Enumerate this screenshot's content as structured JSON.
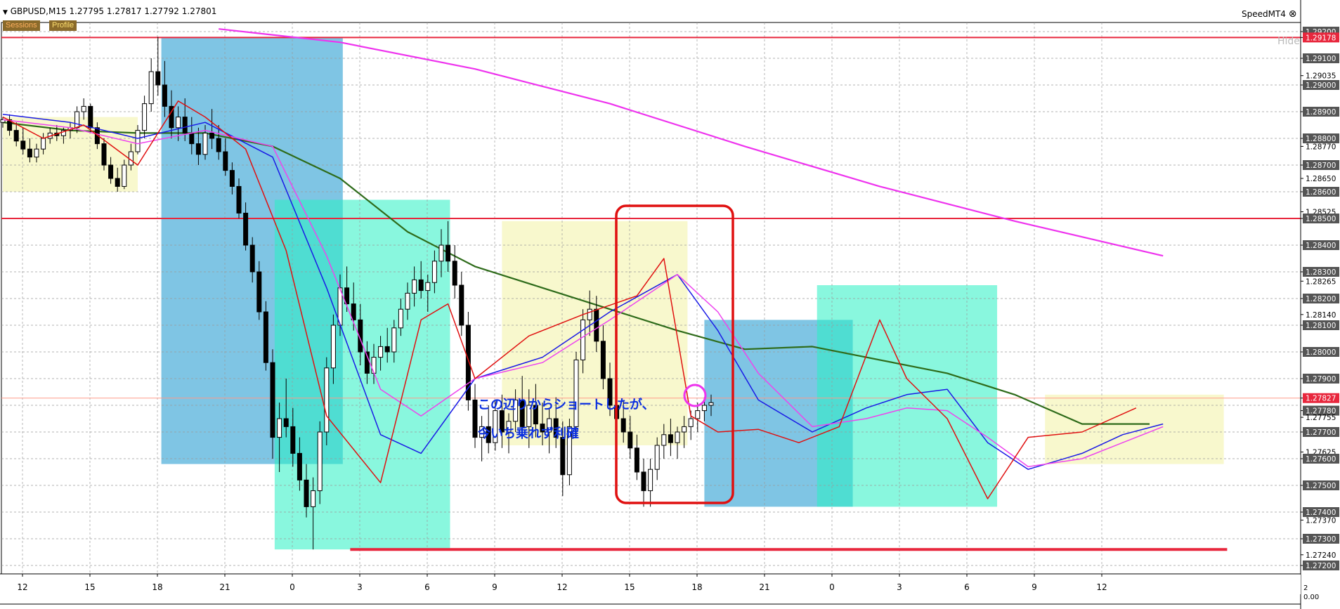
{
  "header": {
    "symbol_info": "GBPUSD,M15",
    "ohlc": "1.27795 1.27817 1.27792 1.27801",
    "indicator_name": "SpeedMT4"
  },
  "buttons": {
    "sessions": "Sessions",
    "profile": "Profile"
  },
  "price_axis_labels": [
    {
      "price": 1.292,
      "text": "1.29200",
      "boxed": true
    },
    {
      "price": 1.29178,
      "text": "1.29178",
      "boxed": true,
      "color": "#e8273d"
    },
    {
      "price": 1.291,
      "text": "1.29100",
      "boxed": true
    },
    {
      "price": 1.29035,
      "text": "1.29035",
      "boxed": false
    },
    {
      "price": 1.29,
      "text": "1.29000",
      "boxed": true
    },
    {
      "price": 1.289,
      "text": "1.28900",
      "boxed": true
    },
    {
      "price": 1.288,
      "text": "1.28800",
      "boxed": true
    },
    {
      "price": 1.2877,
      "text": "1.28770",
      "boxed": false
    },
    {
      "price": 1.287,
      "text": "1.28700",
      "boxed": true
    },
    {
      "price": 1.2865,
      "text": "1.28650",
      "boxed": false
    },
    {
      "price": 1.286,
      "text": "1.28600",
      "boxed": true
    },
    {
      "price": 1.28525,
      "text": "1.28525",
      "boxed": false
    },
    {
      "price": 1.285,
      "text": "1.28500",
      "boxed": true
    },
    {
      "price": 1.284,
      "text": "1.28400",
      "boxed": true
    },
    {
      "price": 1.283,
      "text": "1.28300",
      "boxed": true
    },
    {
      "price": 1.28265,
      "text": "1.28265",
      "boxed": false
    },
    {
      "price": 1.282,
      "text": "1.28200",
      "boxed": true
    },
    {
      "price": 1.2814,
      "text": "1.28140",
      "boxed": false
    },
    {
      "price": 1.281,
      "text": "1.28100",
      "boxed": true
    },
    {
      "price": 1.28,
      "text": "1.28000",
      "boxed": true
    },
    {
      "price": 1.279,
      "text": "1.27900",
      "boxed": true
    },
    {
      "price": 1.27827,
      "text": "1.27827",
      "boxed": true,
      "color": "#e8273d"
    },
    {
      "price": 1.2778,
      "text": "1.27780",
      "boxed": true
    },
    {
      "price": 1.27755,
      "text": "1.27755",
      "boxed": false
    },
    {
      "price": 1.277,
      "text": "1.27700",
      "boxed": true
    },
    {
      "price": 1.27625,
      "text": "1.27625",
      "boxed": false
    },
    {
      "price": 1.276,
      "text": "1.27600",
      "boxed": true
    },
    {
      "price": 1.275,
      "text": "1.27500",
      "boxed": true
    },
    {
      "price": 1.274,
      "text": "1.27400",
      "boxed": true
    },
    {
      "price": 1.2737,
      "text": "1.27370",
      "boxed": false
    },
    {
      "price": 1.273,
      "text": "1.27300",
      "boxed": true
    },
    {
      "price": 1.2724,
      "text": "1.27240",
      "boxed": false
    },
    {
      "price": 1.272,
      "text": "1.27200",
      "boxed": true
    }
  ],
  "time_axis_labels": [
    "12",
    "15",
    "18",
    "21",
    "0",
    "3",
    "6",
    "9",
    "12",
    "15",
    "18",
    "21",
    "0",
    "3",
    "6",
    "9",
    "12"
  ],
  "subpanel_labels": [
    "2",
    "0.00"
  ],
  "hide_label": "Hide",
  "annotations": {
    "line1": "この辺りからショートしたが、",
    "line2": "今いち乗れず利確"
  },
  "colors": {
    "ma_green": "#2e6b1a",
    "ma_magenta_long": "#ee33ee",
    "ma_blue": "#1a1ae6",
    "ma_red": "#e01010",
    "ma_pink": "#ee44ee",
    "hline_red": "#e8273d",
    "annotation_blue": "#0b2fe0"
  },
  "chart_data": {
    "type": "candlestick",
    "symbol": "GBPUSD",
    "timeframe": "M15",
    "ylim": [
      1.2718,
      1.2922
    ],
    "horizontal_lines": [
      1.29178,
      1.285,
      1.27827,
      1.2726
    ],
    "session_boxes": [
      {
        "session": "asia",
        "x": [
          0,
          20
        ],
        "y": [
          1.286,
          1.2888
        ]
      },
      {
        "session": "london",
        "x": [
          23.5,
          50.4
        ],
        "y": [
          1.2758,
          1.29178
        ]
      },
      {
        "session": "newyork",
        "x": [
          40.3,
          66.3
        ],
        "y": [
          1.2726,
          1.2857
        ]
      },
      {
        "session": "asia",
        "x": [
          74,
          101.5
        ],
        "y": [
          1.2765,
          1.2849
        ]
      },
      {
        "session": "london",
        "x": [
          104,
          126
        ],
        "y": [
          1.2742,
          1.2812
        ]
      },
      {
        "session": "newyork",
        "x": [
          120.7,
          147.4
        ],
        "y": [
          1.2742,
          1.2825
        ]
      },
      {
        "session": "asia",
        "x": [
          154.5,
          181
        ],
        "y": [
          1.2758,
          1.2784
        ]
      }
    ],
    "ma_green": [
      [
        0,
        1.2886
      ],
      [
        10,
        1.2883
      ],
      [
        20,
        1.2882
      ],
      [
        30,
        1.2882
      ],
      [
        40,
        1.2877
      ],
      [
        50,
        1.2865
      ],
      [
        60,
        1.2845
      ],
      [
        70,
        1.2832
      ],
      [
        80,
        1.2824
      ],
      [
        90,
        1.2816
      ],
      [
        100,
        1.2808
      ],
      [
        110,
        1.2801
      ],
      [
        120,
        1.2802
      ],
      [
        130,
        1.2797
      ],
      [
        140,
        1.2792
      ],
      [
        150,
        1.2784
      ],
      [
        160,
        1.2773
      ],
      [
        170,
        1.2773
      ]
    ],
    "ma_magenta_long": [
      [
        32,
        1.2921
      ],
      [
        50,
        1.2916
      ],
      [
        70,
        1.2906
      ],
      [
        90,
        1.2893
      ],
      [
        110,
        1.2877
      ],
      [
        130,
        1.2862
      ],
      [
        150,
        1.2849
      ],
      [
        172,
        1.2836
      ]
    ],
    "ma_blue": [
      [
        0,
        1.2889
      ],
      [
        10,
        1.2886
      ],
      [
        20,
        1.288
      ],
      [
        30,
        1.2886
      ],
      [
        40,
        1.2873
      ],
      [
        48,
        1.2824
      ],
      [
        56,
        1.2769
      ],
      [
        62,
        1.2762
      ],
      [
        70,
        1.279
      ],
      [
        80,
        1.2798
      ],
      [
        90,
        1.2815
      ],
      [
        100,
        1.2829
      ],
      [
        106,
        1.2808
      ],
      [
        112,
        1.2782
      ],
      [
        120,
        1.277
      ],
      [
        128,
        1.2779
      ],
      [
        134,
        1.2784
      ],
      [
        140,
        1.2786
      ],
      [
        146,
        1.2766
      ],
      [
        152,
        1.2756
      ],
      [
        160,
        1.2762
      ],
      [
        166,
        1.2769
      ],
      [
        172,
        1.2773
      ]
    ],
    "ma_pink": [
      [
        0,
        1.2887
      ],
      [
        10,
        1.2884
      ],
      [
        20,
        1.2878
      ],
      [
        30,
        1.2883
      ],
      [
        40,
        1.2877
      ],
      [
        48,
        1.2836
      ],
      [
        56,
        1.2786
      ],
      [
        62,
        1.2776
      ],
      [
        70,
        1.279
      ],
      [
        80,
        1.2796
      ],
      [
        90,
        1.2812
      ],
      [
        100,
        1.2829
      ],
      [
        106,
        1.2815
      ],
      [
        112,
        1.2792
      ],
      [
        120,
        1.2772
      ],
      [
        128,
        1.2775
      ],
      [
        134,
        1.2779
      ],
      [
        140,
        1.2778
      ],
      [
        146,
        1.2768
      ],
      [
        152,
        1.2757
      ],
      [
        160,
        1.276
      ],
      [
        166,
        1.2766
      ],
      [
        172,
        1.2772
      ]
    ],
    "ma_red": [
      [
        0,
        1.2888
      ],
      [
        6,
        1.288
      ],
      [
        12,
        1.2885
      ],
      [
        20,
        1.287
      ],
      [
        26,
        1.2894
      ],
      [
        30,
        1.2888
      ],
      [
        36,
        1.2876
      ],
      [
        42,
        1.2838
      ],
      [
        48,
        1.2776
      ],
      [
        56,
        1.2751
      ],
      [
        62,
        1.2812
      ],
      [
        66,
        1.2818
      ],
      [
        70,
        1.279
      ],
      [
        78,
        1.2806
      ],
      [
        86,
        1.2814
      ],
      [
        94,
        1.2821
      ],
      [
        98,
        1.2835
      ],
      [
        102,
        1.2776
      ],
      [
        106,
        1.277
      ],
      [
        112,
        1.2771
      ],
      [
        118,
        1.2766
      ],
      [
        124,
        1.2772
      ],
      [
        130,
        1.2812
      ],
      [
        134,
        1.279
      ],
      [
        140,
        1.2775
      ],
      [
        146,
        1.2745
      ],
      [
        152,
        1.2768
      ],
      [
        160,
        1.277
      ],
      [
        168,
        1.2779
      ]
    ],
    "candles_ohlc": [
      [
        1.2886,
        1.2888,
        1.2884,
        1.2887
      ],
      [
        1.2887,
        1.2889,
        1.2881,
        1.2883
      ],
      [
        1.2883,
        1.2886,
        1.2877,
        1.2879
      ],
      [
        1.2879,
        1.2884,
        1.2874,
        1.2876
      ],
      [
        1.2876,
        1.288,
        1.2871,
        1.2873
      ],
      [
        1.2873,
        1.2878,
        1.2871,
        1.2876
      ],
      [
        1.2876,
        1.2882,
        1.2874,
        1.288
      ],
      [
        1.288,
        1.2884,
        1.2878,
        1.2882
      ],
      [
        1.2882,
        1.2885,
        1.2879,
        1.2881
      ],
      [
        1.2881,
        1.2884,
        1.2878,
        1.2883
      ],
      [
        1.2883,
        1.2886,
        1.288,
        1.2884
      ],
      [
        1.2884,
        1.2892,
        1.2882,
        1.289
      ],
      [
        1.289,
        1.2895,
        1.2887,
        1.2892
      ],
      [
        1.2892,
        1.2893,
        1.2882,
        1.2884
      ],
      [
        1.2884,
        1.2886,
        1.2876,
        1.2878
      ],
      [
        1.2878,
        1.288,
        1.2868,
        1.287
      ],
      [
        1.287,
        1.2873,
        1.2863,
        1.2865
      ],
      [
        1.2865,
        1.2869,
        1.286,
        1.2862
      ],
      [
        1.2862,
        1.2872,
        1.2861,
        1.287
      ],
      [
        1.287,
        1.2878,
        1.2868,
        1.2875
      ],
      [
        1.2875,
        1.2885,
        1.2874,
        1.2883
      ],
      [
        1.2883,
        1.2896,
        1.288,
        1.2893
      ],
      [
        1.2893,
        1.291,
        1.289,
        1.2905
      ],
      [
        1.2905,
        1.2918,
        1.2896,
        1.29
      ],
      [
        1.29,
        1.2909,
        1.2888,
        1.2892
      ],
      [
        1.2892,
        1.2898,
        1.288,
        1.2884
      ],
      [
        1.2884,
        1.2892,
        1.2879,
        1.2888
      ],
      [
        1.2888,
        1.2895,
        1.2879,
        1.2882
      ],
      [
        1.2882,
        1.2888,
        1.2874,
        1.2878
      ],
      [
        1.2878,
        1.2884,
        1.287,
        1.2874
      ],
      [
        1.2874,
        1.2885,
        1.2872,
        1.2882
      ],
      [
        1.2882,
        1.2891,
        1.2876,
        1.288
      ],
      [
        1.288,
        1.2885,
        1.2872,
        1.2875
      ],
      [
        1.2875,
        1.288,
        1.2866,
        1.2868
      ],
      [
        1.2868,
        1.2871,
        1.2859,
        1.2862
      ],
      [
        1.2862,
        1.2865,
        1.285,
        1.2852
      ],
      [
        1.2852,
        1.2856,
        1.2838,
        1.284
      ],
      [
        1.284,
        1.2843,
        1.2826,
        1.283
      ],
      [
        1.283,
        1.2834,
        1.2812,
        1.2815
      ],
      [
        1.2815,
        1.2819,
        1.2793,
        1.2796
      ],
      [
        1.2796,
        1.2801,
        1.276,
        1.2768
      ],
      [
        1.2768,
        1.2781,
        1.2755,
        1.2775
      ],
      [
        1.2775,
        1.279,
        1.2768,
        1.2772
      ],
      [
        1.2772,
        1.2779,
        1.2757,
        1.2762
      ],
      [
        1.2762,
        1.2768,
        1.2748,
        1.2752
      ],
      [
        1.2752,
        1.2758,
        1.2738,
        1.2742
      ],
      [
        1.2742,
        1.2753,
        1.2726,
        1.2748
      ],
      [
        1.2748,
        1.2774,
        1.2743,
        1.277
      ],
      [
        1.277,
        1.2798,
        1.2765,
        1.2794
      ],
      [
        1.2794,
        1.2814,
        1.2788,
        1.281
      ],
      [
        1.281,
        1.2829,
        1.2806,
        1.2824
      ],
      [
        1.2824,
        1.2832,
        1.2815,
        1.2818
      ],
      [
        1.2818,
        1.2826,
        1.2808,
        1.2812
      ],
      [
        1.2812,
        1.2818,
        1.2795,
        1.28
      ],
      [
        1.28,
        1.2804,
        1.2788,
        1.2792
      ],
      [
        1.2792,
        1.2803,
        1.2788,
        1.2798
      ],
      [
        1.2798,
        1.2806,
        1.2793,
        1.2802
      ],
      [
        1.2802,
        1.2809,
        1.2796,
        1.28
      ],
      [
        1.28,
        1.2812,
        1.2796,
        1.2809
      ],
      [
        1.2809,
        1.282,
        1.2806,
        1.2816
      ],
      [
        1.2816,
        1.2826,
        1.2812,
        1.2822
      ],
      [
        1.2822,
        1.2832,
        1.2817,
        1.2827
      ],
      [
        1.2827,
        1.2834,
        1.282,
        1.2823
      ],
      [
        1.2823,
        1.2829,
        1.2815,
        1.2826
      ],
      [
        1.2826,
        1.2838,
        1.2822,
        1.2834
      ],
      [
        1.2834,
        1.2846,
        1.2828,
        1.284
      ],
      [
        1.284,
        1.2849,
        1.283,
        1.2834
      ],
      [
        1.2834,
        1.284,
        1.282,
        1.2825
      ],
      [
        1.2825,
        1.283,
        1.2806,
        1.281
      ],
      [
        1.281,
        1.2815,
        1.2778,
        1.2782
      ],
      [
        1.2782,
        1.2788,
        1.2764,
        1.2768
      ],
      [
        1.2768,
        1.2776,
        1.2759,
        1.2772
      ],
      [
        1.2772,
        1.278,
        1.2762,
        1.2766
      ],
      [
        1.2766,
        1.2782,
        1.2763,
        1.2778
      ],
      [
        1.2778,
        1.2784,
        1.2764,
        1.277
      ],
      [
        1.277,
        1.2777,
        1.2762,
        1.2774
      ],
      [
        1.2774,
        1.2786,
        1.277,
        1.2782
      ],
      [
        1.2782,
        1.2791,
        1.2768,
        1.2772
      ],
      [
        1.2772,
        1.2786,
        1.2764,
        1.278
      ],
      [
        1.278,
        1.2788,
        1.2768,
        1.2773
      ],
      [
        1.2773,
        1.2781,
        1.2765,
        1.277
      ],
      [
        1.277,
        1.2779,
        1.2762,
        1.2775
      ],
      [
        1.2775,
        1.2783,
        1.2764,
        1.2768
      ],
      [
        1.2768,
        1.2774,
        1.2746,
        1.2754
      ],
      [
        1.2754,
        1.2775,
        1.275,
        1.2772
      ],
      [
        1.2772,
        1.28,
        1.2768,
        1.2797
      ],
      [
        1.2797,
        1.2816,
        1.2792,
        1.2812
      ],
      [
        1.2812,
        1.2823,
        1.2806,
        1.2816
      ],
      [
        1.2816,
        1.2821,
        1.28,
        1.2804
      ],
      [
        1.2804,
        1.281,
        1.2786,
        1.279
      ],
      [
        1.279,
        1.2796,
        1.2776,
        1.278
      ],
      [
        1.278,
        1.2788,
        1.277,
        1.2775
      ],
      [
        1.2775,
        1.2782,
        1.2766,
        1.277
      ],
      [
        1.277,
        1.2776,
        1.276,
        1.2764
      ],
      [
        1.2764,
        1.2769,
        1.2752,
        1.2755
      ],
      [
        1.2755,
        1.276,
        1.2742,
        1.2748
      ],
      [
        1.2748,
        1.276,
        1.2742,
        1.2756
      ],
      [
        1.2756,
        1.2768,
        1.2752,
        1.2765
      ],
      [
        1.2765,
        1.2773,
        1.276,
        1.2769
      ],
      [
        1.2769,
        1.2775,
        1.2761,
        1.2766
      ],
      [
        1.2766,
        1.2772,
        1.276,
        1.277
      ],
      [
        1.277,
        1.2776,
        1.2764,
        1.2772
      ],
      [
        1.2772,
        1.2778,
        1.2767,
        1.2775
      ],
      [
        1.2775,
        1.2781,
        1.277,
        1.2778
      ],
      [
        1.2778,
        1.2783,
        1.2774,
        1.278
      ],
      [
        1.278,
        1.2784,
        1.2776,
        1.2781
      ]
    ]
  }
}
